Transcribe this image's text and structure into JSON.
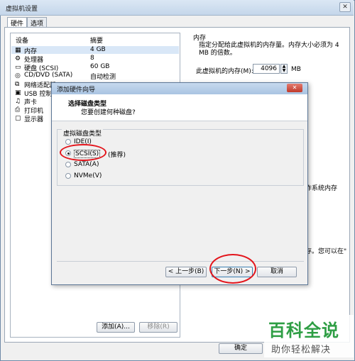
{
  "window": {
    "title": "虚拟机设置",
    "close": "✕"
  },
  "tabs": [
    {
      "label": "硬件"
    },
    {
      "label": "选项"
    }
  ],
  "device_list": {
    "header_device": "设备",
    "header_summary": "摘要",
    "rows": [
      {
        "icon": "▦",
        "name": "内存",
        "summary": "4 GB",
        "selected": true
      },
      {
        "icon": "⚙",
        "name": "处理器",
        "summary": "8"
      },
      {
        "icon": "▭",
        "name": "硬盘 (SCSI)",
        "summary": "60 GB"
      },
      {
        "icon": "◎",
        "name": "CD/DVD (SATA)",
        "summary": "自动检测"
      },
      {
        "icon": "⧉",
        "name": "网络适配器",
        "summary": ""
      },
      {
        "icon": "▣",
        "name": "USB 控制器",
        "summary": ""
      },
      {
        "icon": "♫",
        "name": "声卡",
        "summary": ""
      },
      {
        "icon": "⎙",
        "name": "打印机",
        "summary": ""
      },
      {
        "icon": "▢",
        "name": "显示器",
        "summary": ""
      }
    ]
  },
  "memory": {
    "title": "内存",
    "description": "指定分配给此虚拟机的内存量。内存大小必须为 4 MB 的倍数。",
    "label": "此虚拟机的内存(M):",
    "value": "4096",
    "unit": "MB",
    "side_text_1": "作系统内存",
    "side_text_2": "存。您可以在\""
  },
  "buttons": {
    "add": "添加(A)...",
    "remove": "移除(R)",
    "ok": "确定"
  },
  "dialog": {
    "title": "添加硬件向导",
    "close": "✕",
    "heading": "选择磁盘类型",
    "subheading": "您要创建何种磁盘?",
    "group_title": "虚拟磁盘类型",
    "options": [
      {
        "label": "IDE(I)",
        "selected": false
      },
      {
        "label": "SCSI(S)",
        "selected": true,
        "note": "(推荐)"
      },
      {
        "label": "SATA(A)",
        "selected": false
      },
      {
        "label": "NVMe(V)",
        "selected": false
      }
    ],
    "back": "< 上一步(B)",
    "next": "下一步(N) >",
    "cancel": "取消"
  },
  "watermark": {
    "title": "百科全说",
    "subtitle": "助你轻松解决"
  }
}
